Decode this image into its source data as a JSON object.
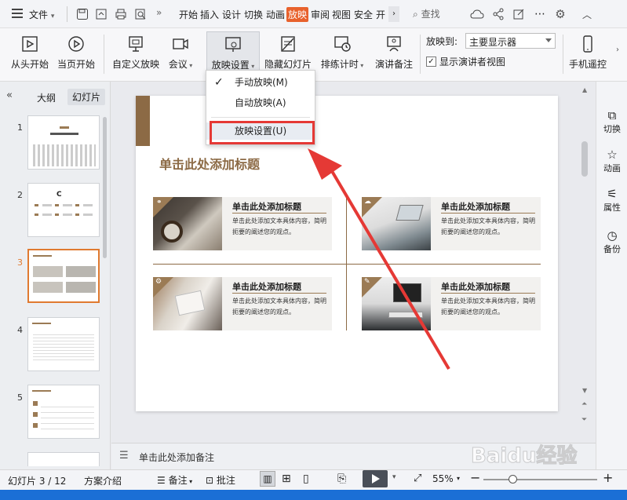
{
  "menu": {
    "file": "文件",
    "tabs": [
      "开始",
      "插入",
      "设计",
      "切换",
      "动画",
      "放映",
      "审阅",
      "视图",
      "安全",
      "开"
    ],
    "search": "查找"
  },
  "ribbon": {
    "from_start": "从头开始",
    "from_current": "当页开始",
    "custom_show": "自定义放映",
    "meeting": "会议",
    "show_settings": "放映设置",
    "hide_slide": "隐藏幻灯片",
    "rehearse": "排练计时",
    "speaker_notes": "演讲备注",
    "show_to_label": "放映到:",
    "show_to_value": "主要显示器",
    "presenter_view": "显示演讲者视图",
    "phone_remote": "手机遥控"
  },
  "dropdown": {
    "items": [
      "手动放映(M)",
      "自动放映(A)",
      "放映设置(U)"
    ]
  },
  "panel": {
    "tab_outline": "大纲",
    "tab_slides": "幻灯片",
    "thumb_numbers": [
      "1",
      "2",
      "3",
      "4",
      "5"
    ]
  },
  "slide": {
    "title": "单击此处添加标题",
    "cards": [
      {
        "title": "单击此处添加标题",
        "text": "单击此处添加文本具体内容，简明扼要的阐述您的观点。"
      },
      {
        "title": "单击此处添加标题",
        "text": "单击此处添加文本具体内容，简明扼要的阐述您的观点。"
      },
      {
        "title": "单击此处添加标题",
        "text": "单击此处添加文本具体内容，简明扼要的阐述您的观点。"
      },
      {
        "title": "单击此处添加标题",
        "text": "单击此处添加文本具体内容，简明扼要的阐述您的观点。"
      }
    ]
  },
  "notes": {
    "placeholder": "单击此处添加备注"
  },
  "right_panel": {
    "items": [
      "切换",
      "动画",
      "属性",
      "备份"
    ]
  },
  "status": {
    "slide_counter": "幻灯片 3 / 12",
    "theme": "方案介绍",
    "notes": "备注",
    "comments": "批注",
    "zoom": "55%"
  },
  "watermark": "Baidu经验",
  "colors": {
    "accent": "#8c6a45",
    "highlight_red": "#e53935",
    "active_tab": "#e8612c"
  }
}
